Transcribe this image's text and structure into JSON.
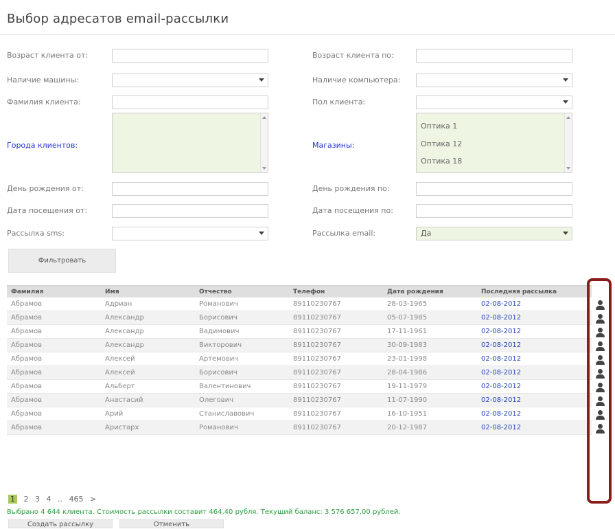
{
  "page": {
    "title": "Выбор адресатов email-рассылки"
  },
  "filters": {
    "age_from": {
      "label": "Возраст клиента от:",
      "value": ""
    },
    "age_to": {
      "label": "Возраст клиента по:",
      "value": ""
    },
    "has_car": {
      "label": "Наличие машины:",
      "value": ""
    },
    "has_computer": {
      "label": "Наличие компьютера:",
      "value": ""
    },
    "surname": {
      "label": "Фамилия клиента:",
      "value": ""
    },
    "gender": {
      "label": "Пол клиента:",
      "value": ""
    },
    "cities": {
      "label": "Города клиентов:",
      "options": []
    },
    "shops": {
      "label": "Магазины:",
      "options": [
        "Оптика 1",
        "Оптика 12",
        "Оптика 18"
      ]
    },
    "birthday_from": {
      "label": "День рождения от:",
      "value": ""
    },
    "birthday_to": {
      "label": "День рождения по:",
      "value": ""
    },
    "visit_from": {
      "label": "Дата посещения от:",
      "value": ""
    },
    "visit_to": {
      "label": "Дата посещения по:",
      "value": ""
    },
    "sms": {
      "label": "Рассылка sms:",
      "value": ""
    },
    "email": {
      "label": "Рассылка email:",
      "value": "Да"
    },
    "filter_button": "Фильтровать"
  },
  "table": {
    "columns": [
      "Фамилия",
      "Имя",
      "Отчество",
      "Телефон",
      "Дата рождения",
      "Последняя рассылка"
    ],
    "rows": [
      [
        "Абрамов",
        "Адриан",
        "Романович",
        "89110230767",
        "28-03-1965",
        "02-08-2012"
      ],
      [
        "Абрамов",
        "Александр",
        "Борисович",
        "89110230767",
        "05-07-1985",
        "02-08-2012"
      ],
      [
        "Абрамов",
        "Александр",
        "Вадимович",
        "89110230767",
        "17-11-1961",
        "02-08-2012"
      ],
      [
        "Абрамов",
        "Александр",
        "Викторович",
        "89110230767",
        "30-09-1983",
        "02-08-2012"
      ],
      [
        "Абрамов",
        "Алексей",
        "Артемович",
        "89110230767",
        "23-01-1998",
        "02-08-2012"
      ],
      [
        "Абрамов",
        "Алексей",
        "Борисович",
        "89110230767",
        "28-04-1986",
        "02-08-2012"
      ],
      [
        "Абрамов",
        "Альберт",
        "Валентинович",
        "89110230767",
        "19-11-1979",
        "02-08-2012"
      ],
      [
        "Абрамов",
        "Анастасий",
        "Олегович",
        "89110230767",
        "11-07-1990",
        "02-08-2012"
      ],
      [
        "Абрамов",
        "Арий",
        "Станиславович",
        "89110230767",
        "16-10-1951",
        "02-08-2012"
      ],
      [
        "Абрамов",
        "Аристарх",
        "Романович",
        "89110230767",
        "20-12-1987",
        "02-08-2012"
      ]
    ],
    "row_icon": "user-icon",
    "highlight_color": "#8a1c1c"
  },
  "pager": {
    "current": "1",
    "pages": [
      "2",
      "3",
      "4",
      "..",
      "465"
    ],
    "next": ">"
  },
  "summary": "Выбрано 4 644 клиента. Стоимость рассылки составит 464,40 рубля. Текущий баланс: 3 576 657,00 рублей.",
  "actions": {
    "create": "Создать рассылку",
    "cancel": "Отменить"
  }
}
